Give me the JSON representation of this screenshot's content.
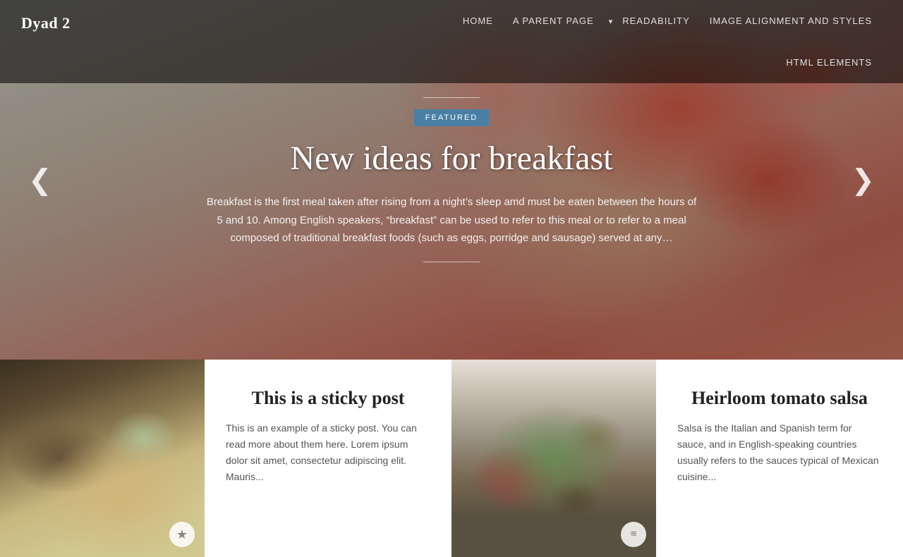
{
  "site": {
    "logo": "Dyad 2"
  },
  "nav": {
    "links": [
      {
        "label": "HOME",
        "dropdown": false
      },
      {
        "label": "A PARENT PAGE",
        "dropdown": true
      },
      {
        "label": "READABILITY",
        "dropdown": false
      },
      {
        "label": "IMAGE ALIGNMENT AND STYLES",
        "dropdown": false
      },
      {
        "label": "HTML ELEMENTS",
        "dropdown": false
      }
    ]
  },
  "hero": {
    "badge": "FEATURED",
    "title": "New ideas for breakfast",
    "description": "Breakfast is the first meal taken after rising from a night’s sleep amd must be eaten between the hours of 5 and 10. Among English speakers, “breakfast” can be used to refer to this meal or to refer to a meal composed of traditional breakfast foods (such as eggs, porridge and sausage) served at any…",
    "prev_arrow": "❮",
    "next_arrow": "❯"
  },
  "grid": {
    "col1": {
      "type": "image",
      "badge_icon": "★"
    },
    "col2": {
      "type": "text",
      "title": "This is a sticky post",
      "excerpt": "This is an example of a sticky post. You can read more about them here. Lorem ipsum dolor sit amet, consectetur adipiscing elit. Mauris..."
    },
    "col3": {
      "type": "image",
      "badge_icon": "≡"
    },
    "col4": {
      "type": "text",
      "title": "Heirloom tomato salsa",
      "excerpt": "Salsa is the Italian and Spanish term for sauce, and in English-speaking countries usually refers to the sauces typical of Mexican cuisine..."
    }
  }
}
